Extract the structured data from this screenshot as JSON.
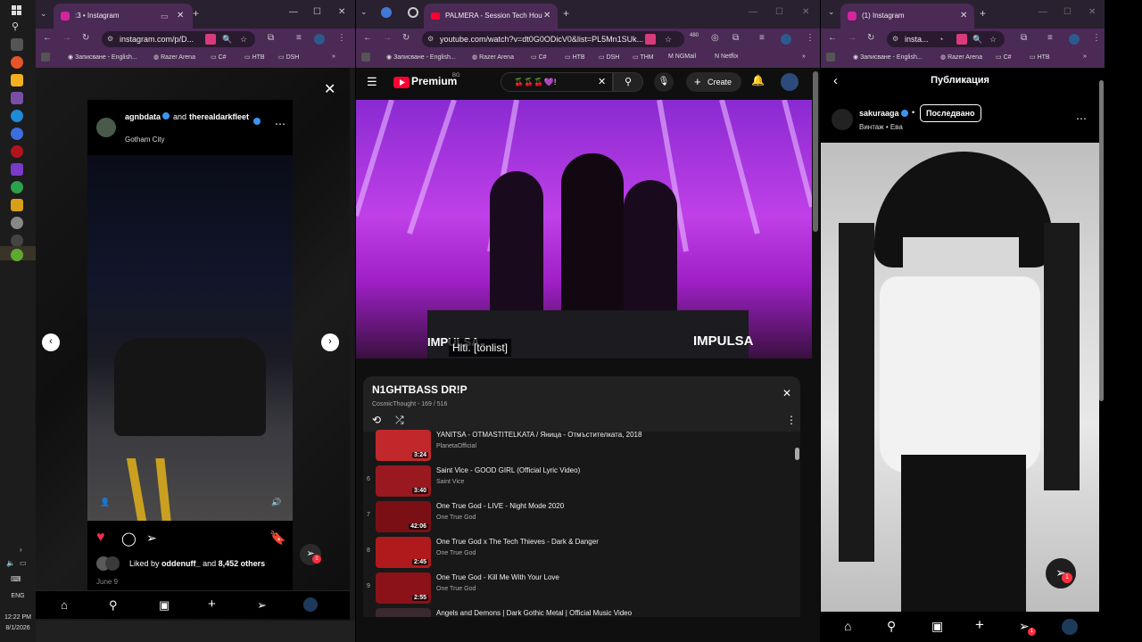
{
  "taskbar": {
    "language": "ENG",
    "time": "12:22 PM",
    "date": "8/1/2026"
  },
  "win1": {
    "tab_title": ":3 • Instagram",
    "url": "instagram.com/p/D...",
    "bookmarks": [
      "Записване - English...",
      "Razer Arena",
      "C#",
      "HTB",
      "DSH"
    ],
    "post": {
      "user1": "agnbdata",
      "and": "and",
      "user2": "therealdarkfleet",
      "location": "Gotham City",
      "liked_prefix": "Liked by",
      "liked_user": "oddenuff_",
      "liked_and": "and",
      "liked_count": "8,452 others",
      "date": "June 9",
      "notif_count": "1"
    }
  },
  "win2": {
    "tab_title": "PALMERA - Session Tech Hou",
    "url": "youtube.com/watch?v=dt0G0ODicV0&list=PL5Mn1SUk...",
    "ext_badge": "480",
    "bookmarks": [
      "Записване - English...",
      "Razer Arena",
      "C#",
      "HTB",
      "DSH",
      "THM",
      "NGMail",
      "Netflix"
    ],
    "header": {
      "logo": "Premium",
      "logo_sup": "BG",
      "search_value": "🍒🍒🍒💜!",
      "create_label": "Create"
    },
    "video": {
      "caption": "Hiti.  [tönlist]",
      "watermark": "IMPULSA"
    },
    "playlist": {
      "title": "N1GHTBASS DR!P",
      "subtitle": "CosmicThought - 169 / 516",
      "items": [
        {
          "index": "",
          "title": "YANITSA - OTMASTITELKATA / Яница - Отмъстителката, 2018",
          "channel": "PlanetaOfficial",
          "duration": "3:24",
          "color": "#c0282c"
        },
        {
          "index": "6",
          "title": "Saint Vice - GOOD GIRL (Official Lyric Video)",
          "channel": "Saint Vice",
          "duration": "3:40",
          "color": "#9a1820"
        },
        {
          "index": "7",
          "title": "One True God - LIVE - Night Mode 2020",
          "channel": "One True God",
          "duration": "42:06",
          "color": "#7a1016"
        },
        {
          "index": "8",
          "title": "One True God x The Tech Thieves - Dark & Danger",
          "channel": "One True God",
          "duration": "2:45",
          "color": "#b01a1c"
        },
        {
          "index": "9",
          "title": "One True God - Kill Me With Your Love",
          "channel": "One True God",
          "duration": "2:55",
          "color": "#8a1218"
        },
        {
          "index": "",
          "title": "Angels and Demons | Dark Gothic Metal | Official Music Video",
          "channel": "",
          "duration": "",
          "color": "#3a2a30"
        }
      ]
    }
  },
  "win3": {
    "tab_title": "(1) Instagram",
    "url": "insta...",
    "bookmarks": [
      "Записване - English...",
      "Razer Arena",
      "C#",
      "HTB"
    ],
    "page_title": "Публикация",
    "username": "sakuraaga",
    "dot": "•",
    "follow_label": "Последвано",
    "music": "Винтаж • Ева",
    "notif_count": "1"
  }
}
